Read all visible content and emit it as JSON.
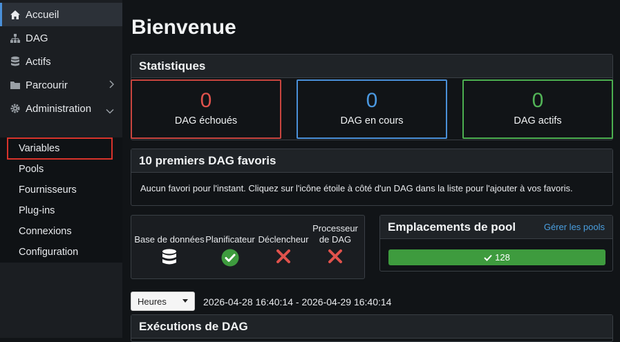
{
  "sidebar": {
    "items": [
      {
        "label": "Accueil",
        "icon": "home-icon"
      },
      {
        "label": "DAG",
        "icon": "sitemap-icon"
      },
      {
        "label": "Actifs",
        "icon": "database-icon"
      },
      {
        "label": "Parcourir",
        "icon": "folder-icon"
      },
      {
        "label": "Administration",
        "icon": "gear-icon"
      }
    ],
    "admin_submenu": [
      "Variables",
      "Pools",
      "Fournisseurs",
      "Plug-ins",
      "Connexions",
      "Configuration"
    ]
  },
  "page": {
    "title": "Bienvenue"
  },
  "stats": {
    "title": "Statistiques",
    "cards": [
      {
        "value": "0",
        "label": "DAG échoués",
        "color": "#d9534f"
      },
      {
        "value": "0",
        "label": "DAG en cours",
        "color": "#4a90d9"
      },
      {
        "value": "0",
        "label": "DAG actifs",
        "color": "#4caf50"
      }
    ]
  },
  "favorites": {
    "title": "10 premiers DAG favoris",
    "empty_text": "Aucun favori pour l'instant. Cliquez sur l'icône étoile à côté d'un DAG dans la liste pour l'ajouter à vos favoris."
  },
  "health": {
    "items": [
      {
        "label": "Base de données",
        "status": "database-icon"
      },
      {
        "label": "Planificateur",
        "status": "check-circle-icon"
      },
      {
        "label": "Déclencheur",
        "status": "x-icon"
      },
      {
        "label_line1": "Processeur",
        "label_line2": "de DAG",
        "status": "x-icon"
      }
    ]
  },
  "pools": {
    "title": "Emplacements de pool",
    "manage_link": "Gérer les pools",
    "open_slots": "128"
  },
  "filter": {
    "selected": "Heures",
    "range": "2026-04-28 16:40:14 - 2026-04-29 16:40:14"
  },
  "runs": {
    "title": "Exécutions de DAG"
  }
}
